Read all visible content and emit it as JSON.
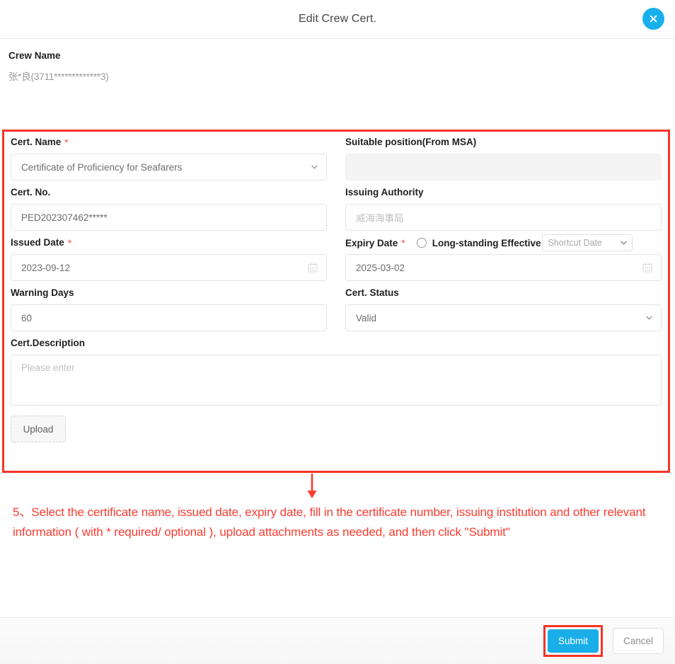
{
  "modal": {
    "title": "Edit Crew Cert.",
    "close_icon": "close-icon"
  },
  "crew": {
    "label": "Crew Name",
    "value": "张*良(3711*************3)"
  },
  "form": {
    "cert_name": {
      "label": "Cert. Name",
      "required": "*",
      "value": "Certificate of Proficiency for Seafarers"
    },
    "suitable_position": {
      "label": "Suitable position(From MSA)",
      "value": ""
    },
    "cert_no": {
      "label": "Cert. No.",
      "value": "PED202307462*****"
    },
    "issuing_authority": {
      "label": "Issuing Authority",
      "placeholder": "威海海事局"
    },
    "issued_date": {
      "label": "Issued Date",
      "required": "*",
      "value": "2023-09-12"
    },
    "expiry_date": {
      "label": "Expiry Date",
      "required": "*",
      "value": "2025-03-02",
      "long_standing_label": "Long-standing Effective",
      "shortcut_placeholder": "Shortcut Date"
    },
    "warning_days": {
      "label": "Warning Days",
      "value": "60"
    },
    "cert_status": {
      "label": "Cert. Status",
      "value": "Valid"
    },
    "cert_description": {
      "label": "Cert.Description",
      "placeholder": "Please enter"
    },
    "upload": {
      "label": "Upload"
    }
  },
  "annotation": {
    "text": "5、Select the certificate name, issued date, expiry date, fill in the certificate number, issuing institution and other relevant information ( with * required/ optional ), upload attachments as needed, and then click \"Submit\"",
    "color": "#fb3b30"
  },
  "footer": {
    "submit_label": "Submit",
    "cancel_label": "Cancel"
  },
  "colors": {
    "accent": "#19aee8",
    "highlight": "#f5342a",
    "required": "#f5533d"
  }
}
